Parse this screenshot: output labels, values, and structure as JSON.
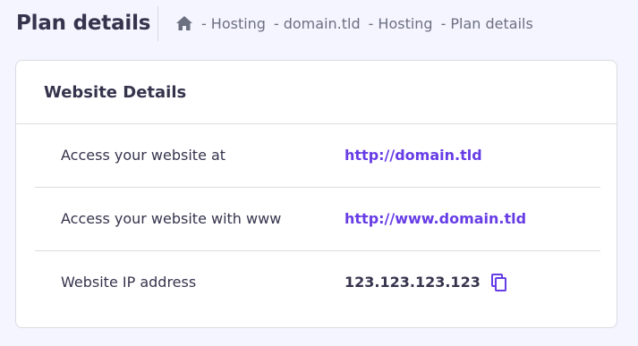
{
  "header": {
    "title": "Plan details",
    "breadcrumb": [
      {
        "label": "Hosting"
      },
      {
        "label": "domain.tld"
      },
      {
        "label": "Hosting"
      },
      {
        "label": "Plan details"
      }
    ],
    "separator": "-"
  },
  "card": {
    "title": "Website Details",
    "rows": [
      {
        "label": "Access your website at",
        "value": "http://domain.tld"
      },
      {
        "label": "Access your website with www",
        "value": "http://www.domain.tld"
      },
      {
        "label": "Website IP address",
        "value": "123.123.123.123"
      }
    ]
  },
  "icons": {
    "home": "home-icon",
    "copy": "copy-icon"
  },
  "colors": {
    "accent": "#673de6",
    "text": "#36344d",
    "muted": "#6d7081",
    "background": "#f4f5ff"
  }
}
